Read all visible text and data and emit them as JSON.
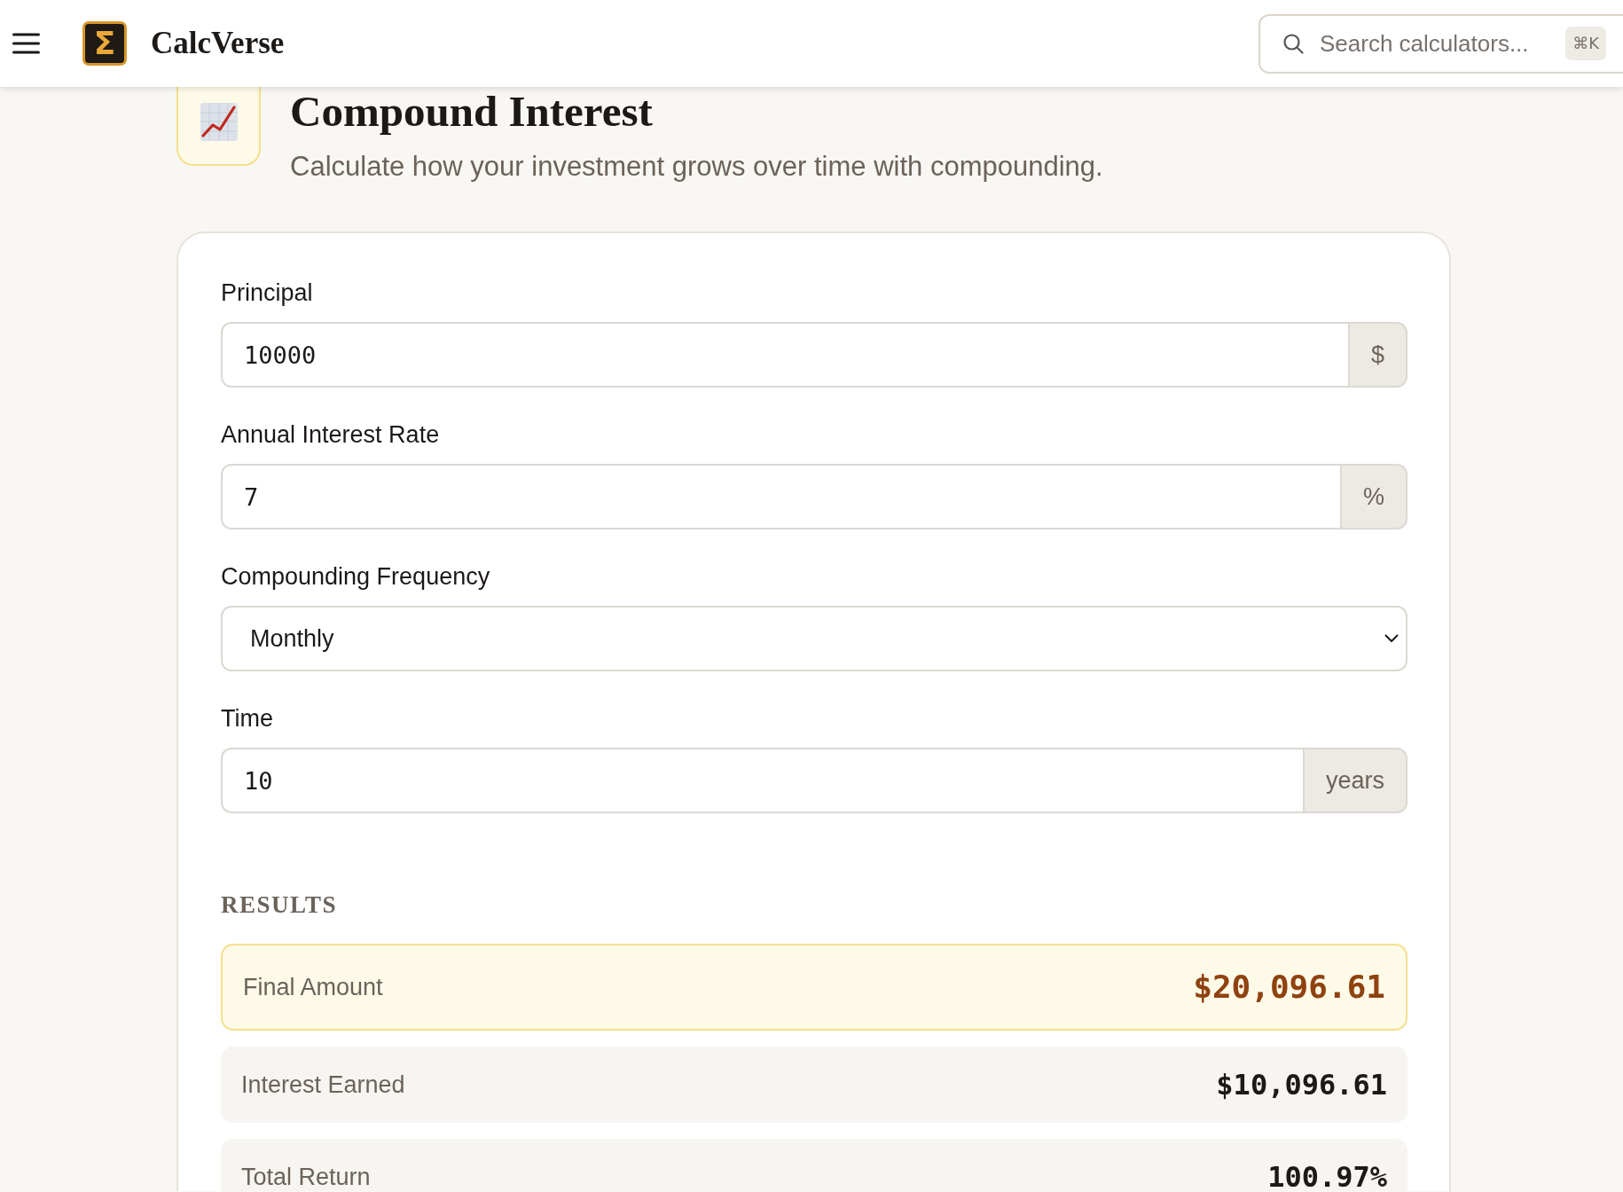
{
  "header": {
    "logo_symbol": "Σ",
    "brand": "CalcVerse",
    "search": {
      "placeholder": "Search calculators...",
      "shortcut": "⌘K"
    }
  },
  "page": {
    "title": "Compound Interest",
    "subtitle": "Calculate how your investment grows over time with compounding."
  },
  "form": {
    "fields": [
      {
        "kind": "input",
        "label": "Principal",
        "value": "10000",
        "suffix": "$"
      },
      {
        "kind": "input",
        "label": "Annual Interest Rate",
        "value": "7",
        "suffix": "%"
      },
      {
        "kind": "select",
        "label": "Compounding Frequency",
        "value": "Monthly"
      },
      {
        "kind": "input",
        "label": "Time",
        "value": "10",
        "suffix": "years"
      }
    ]
  },
  "results": {
    "heading": "RESULTS",
    "items": [
      {
        "label": "Final Amount",
        "value": "$20,096.61",
        "highlighted": true
      },
      {
        "label": "Interest Earned",
        "value": "$10,096.61",
        "highlighted": false
      },
      {
        "label": "Total Return",
        "value": "100.97%",
        "highlighted": false
      }
    ]
  }
}
